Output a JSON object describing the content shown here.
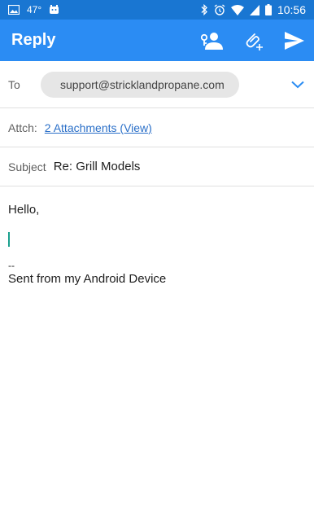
{
  "status_bar": {
    "temperature": "47°",
    "time": "10:56"
  },
  "app_bar": {
    "title": "Reply",
    "icons": [
      "contact-picker-icon",
      "attach-icon",
      "send-icon"
    ]
  },
  "to": {
    "label": "To",
    "recipient": "support@stricklandpropane.com"
  },
  "attachments": {
    "label": "Attch:",
    "link_text": "2 Attachments (View)"
  },
  "subject": {
    "label": "Subject",
    "value": "Re: Grill Models"
  },
  "body": {
    "greeting": "Hello,",
    "signature_separator": "--",
    "signature": "Sent from my Android Device"
  },
  "colors": {
    "status_bar": "#1976d2",
    "app_bar": "#2b8cf3",
    "link": "#2a6fc8",
    "cursor": "#1aa08e"
  }
}
